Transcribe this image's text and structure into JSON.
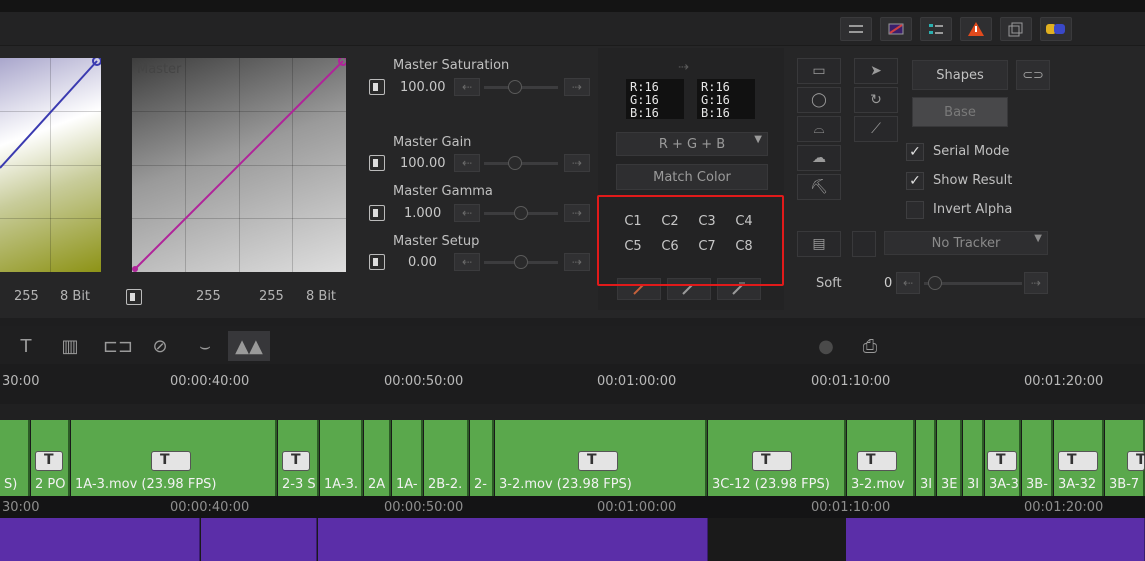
{
  "curves": {
    "left_readout": {
      "a": "255",
      "b": "8 Bit"
    },
    "master_label": "Master",
    "master_readout": {
      "a": "255",
      "b": "255",
      "c": "8 Bit"
    }
  },
  "sliders": [
    {
      "label": "Master Saturation",
      "value": "100.00"
    },
    {
      "label": "Master Gain",
      "value": "100.00"
    },
    {
      "label": "Master Gamma",
      "value": "1.000"
    },
    {
      "label": "Master Setup",
      "value": "0.00"
    }
  ],
  "match": {
    "source_rgb": [
      "R:16",
      "G:16",
      "B:16"
    ],
    "target_rgb": [
      "R:16",
      "G:16",
      "B:16"
    ],
    "mode_select": "R + G + B",
    "match_color_label": "Match Color",
    "chips": [
      "C1",
      "C2",
      "C3",
      "C4",
      "C5",
      "C6",
      "C7",
      "C8"
    ],
    "highlight_color": "#e11a1a"
  },
  "shapes": {
    "shapes_label": "Shapes",
    "base_label": "Base",
    "serial_mode": "Serial Mode",
    "show_result": "Show Result",
    "invert_alpha": "Invert Alpha",
    "tracker": "No Tracker",
    "soft_label": "Soft",
    "soft_value": "0"
  },
  "timeline": {
    "ruler": [
      "30:00",
      "00:00:40:00",
      "00:00:50:00",
      "00:01:00:00",
      "00:01:10:00",
      "00:01:20:00"
    ],
    "clips": [
      "S)",
      "2 PO",
      "1A-3.mov (23.98 FPS)",
      "2-3 S",
      "1A-3.",
      "2A",
      "1A-",
      "2B-2.",
      "2-",
      "3-2.mov (23.98 FPS)",
      "3C-12 (23.98 FPS)",
      "3-2.mov",
      "3I",
      "3E",
      "3I",
      "3A-3",
      "3B-",
      "3A-32",
      "3B-7"
    ],
    "ruler2": [
      "30:00",
      "00:00:40:00",
      "00:00:50:00",
      "00:01:00:00",
      "00:01:10:00",
      "00:01:20:00"
    ],
    "video_color": "#5aa84c",
    "audio_color": "#5b2ea8"
  }
}
